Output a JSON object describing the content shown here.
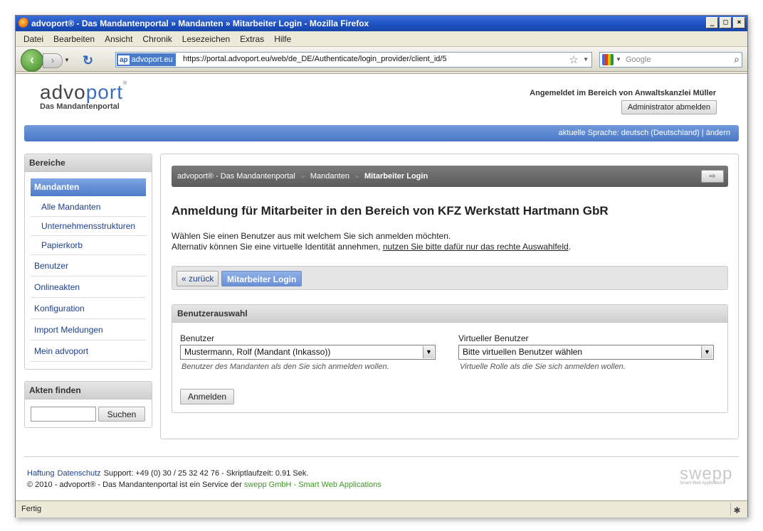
{
  "window": {
    "title": "advoport® - Das Mandantenportal » Mandanten » Mitarbeiter Login - Mozilla Firefox",
    "min": "_",
    "max": "□",
    "close": "×"
  },
  "menu": [
    "Datei",
    "Bearbeiten",
    "Ansicht",
    "Chronik",
    "Lesezeichen",
    "Extras",
    "Hilfe"
  ],
  "nav": {
    "site_badge": "ap",
    "site_name": "advoport.eu",
    "url": "https://portal.advoport.eu/web/de_DE/Authenticate/login_provider/client_id/5",
    "search_placeholder": "Google"
  },
  "header": {
    "logo_main_a": "advo",
    "logo_main_b": "port",
    "logo_reg": "®",
    "logo_sub": "Das Mandantenportal",
    "logged_in": "Angemeldet im Bereich von Anwaltskanzlei Müller",
    "logout_label": "Administrator abmelden",
    "language_text": "aktuelle Sprache: deutsch (Deutschland) | ",
    "language_link": "ändern"
  },
  "sidebar": {
    "title": "Bereiche",
    "active": "Mandanten",
    "sub_items": [
      "Alle Mandanten",
      "Unternehmensstrukturen",
      "Papierkorb"
    ],
    "items": [
      "Benutzer",
      "Onlineakten",
      "Konfiguration",
      "Import Meldungen",
      "Mein advoport"
    ]
  },
  "finder": {
    "title": "Akten finden",
    "search_value": "",
    "search_label": "Suchen"
  },
  "breadcrumb": {
    "items": [
      "advoport® - Das Mandantenportal",
      "Mandanten"
    ],
    "current": "Mitarbeiter Login",
    "separator": "»"
  },
  "main": {
    "heading": "Anmeldung für Mitarbeiter in den Bereich von KFZ Werkstatt Hartmann GbR",
    "intro_line1": "Wählen Sie einen Benutzer aus mit welchem Sie sich anmelden möchten.",
    "intro_line2_prefix": "Alternativ können Sie eine virtuelle Identität annehmen, ",
    "intro_link": "nutzen Sie bitte dafür nur das rechte Auswahlfeld",
    "intro_line2_suffix": ".",
    "back_label": "« zurück",
    "current_label": "Mitarbeiter Login"
  },
  "form": {
    "panel_title": "Benutzerauswahl",
    "user_label": "Benutzer",
    "user_value": "Mustermann, Rolf (Mandant (Inkasso))",
    "user_hint": "Benutzer des Mandanten als den Sie sich anmelden wollen.",
    "virtual_label": "Virtueller Benutzer",
    "virtual_value": "Bitte virtuellen Benutzer wählen",
    "virtual_hint": "Virtuelle Rolle als die Sie sich anmelden wollen.",
    "submit_label": "Anmelden"
  },
  "footer": {
    "link1": "Haftung",
    "link2": "Datenschutz",
    "support": "Support: +49 (0) 30 / 25 32 42 76 - Skriptlaufzeit: 0.91 Sek.",
    "copyright_prefix": "© 2010 - advoport® - Das Mandantenportal ist ein Service der ",
    "copyright_link": "swepp GmbH - Smart Web Applications",
    "brand": "swepp",
    "brand_sub": "Smart Web Applications"
  },
  "status": {
    "text": "Fertig"
  },
  "colors": {
    "accent": "#4e7ac8",
    "breadcrumb_bg": "#5a5a5a",
    "link_green": "#3a9a20"
  }
}
